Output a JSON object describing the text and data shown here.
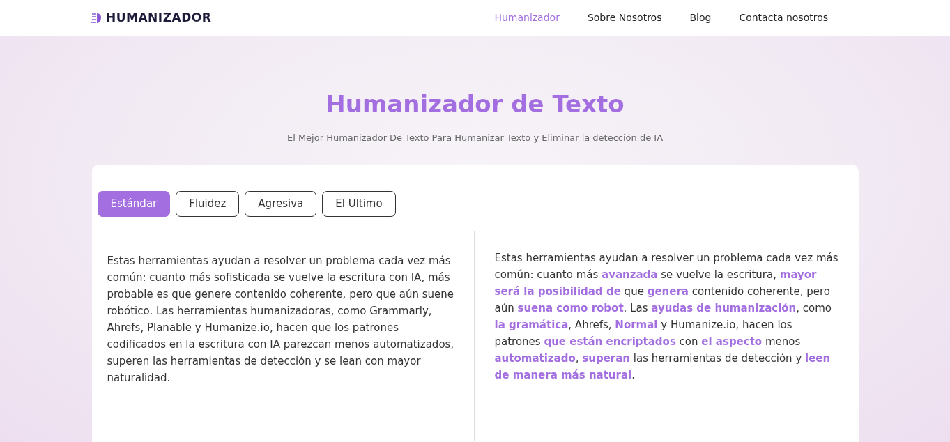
{
  "brand": {
    "name": "HUMANIZADOR"
  },
  "nav": [
    {
      "label": "Humanizador",
      "selected": true
    },
    {
      "label": "Sobre Nosotros",
      "selected": false
    },
    {
      "label": "Blog",
      "selected": false
    },
    {
      "label": "Contacta nosotros",
      "selected": false
    }
  ],
  "hero": {
    "title": "Humanizador de Texto",
    "subtitle": "El Mejor Humanizador De Texto Para Humanizar Texto y Eliminar la detección de IA"
  },
  "modes": [
    {
      "label": "Estándar",
      "selected": true
    },
    {
      "label": "Fluidez",
      "selected": false
    },
    {
      "label": "Agresiva",
      "selected": false
    },
    {
      "label": "El Ultimo",
      "selected": false
    }
  ],
  "input_text": "Estas herramientas ayudan a resolver un problema cada vez más común: cuanto más sofisticada se vuelve la escritura con IA, más probable es que genere contenido coherente, pero que aún suene robótico. Las herramientas humanizadoras, como Grammarly, Ahrefs, Planable y Humanize.io, hacen que los patrones codificados en la escritura con IA parezcan menos automatizados, superen las herramientas de detección y se lean con mayor naturalidad.",
  "output_text": "Estas herramientas ayudan a resolver un problema cada vez más común: cuanto más **avanzada** se vuelve la escritura, **mayor será la posibilidad de** que **genera** contenido coherente, pero aún **suena como robot**. Las **ayudas de humanización**, como **la gramática**, Ahrefs, **Normal** y Humanize.io, hacen los patrones **que están encriptados** con **el aspecto** menos **automatizado**, **superan** las herramientas de detección y **leen de manera más natural**."
}
